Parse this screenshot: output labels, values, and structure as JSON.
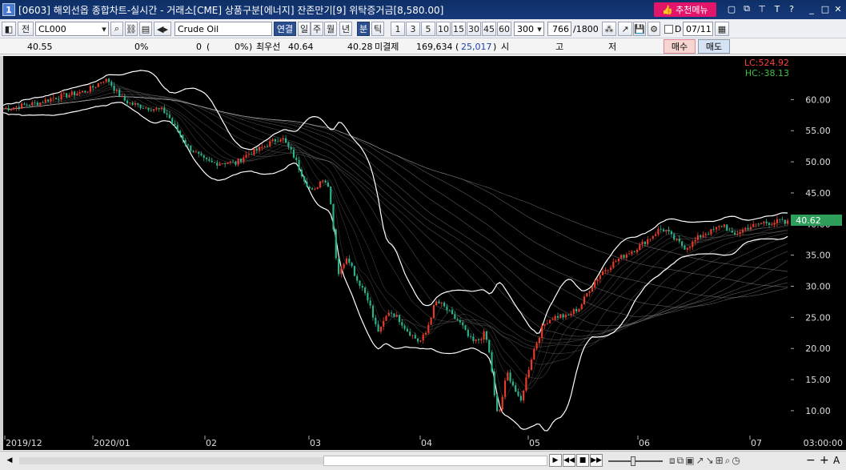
{
  "titlebar": {
    "window_number": "1",
    "title": "[0603] 해외선옵 종합차트-실시간 - 거래소[CME] 상품구분[에너지] 잔존만기[9] 위탁증거금[8,580.00]",
    "recommend_menu": "추천메뉴",
    "pin_label": "T",
    "help_label": "?"
  },
  "toolbar": {
    "market_label": "전",
    "symbol": "CL000",
    "name": "Crude Oil",
    "connect_label": "연결",
    "periods": [
      "일",
      "주",
      "월",
      "년",
      "분",
      "틱"
    ],
    "selected_period": "분",
    "intervals": [
      "1",
      "3",
      "5",
      "10",
      "15",
      "30",
      "45",
      "60"
    ],
    "count": "300",
    "scroll_pos": "766",
    "scroll_total": "/1800",
    "d_label": "D",
    "date": "07/11"
  },
  "quote": {
    "price": "40.55",
    "change_pct": "0%",
    "volume": "0",
    "vol_pct_open": "(",
    "vol_pct": "0%",
    "vol_pct_close": ")",
    "best_ask_label": "최우선",
    "best_ask": "40.64",
    "best_bid": "40.28",
    "open_interest_label": "미결제",
    "open_interest": "169,634",
    "oi_change_open": "(",
    "oi_change": "25,017",
    "oi_change_close": ")",
    "open_label": "시",
    "high_label": "고",
    "low_label": "저",
    "buy_label": "매수",
    "sell_label": "매도"
  },
  "chart": {
    "lc_label": "LC:524.92",
    "hc_label": "HC:-38.13",
    "last_price": "40.62",
    "y_ticks": [
      "60.00",
      "55.00",
      "50.00",
      "45.00",
      "40.00",
      "35.00",
      "30.00",
      "25.00",
      "20.00",
      "15.00",
      "10.00"
    ],
    "x_labels": [
      "2019/12",
      "2020/01",
      "02",
      "03",
      "04",
      "05",
      "06",
      "07"
    ],
    "x_last": "03:00:00",
    "colors": {
      "up": "#e83a2a",
      "down": "#2bb08a",
      "band": "#ffffff",
      "ma": "#9a9a9a",
      "last_price_bg": "#2e9e5b",
      "lc": "#ff4040",
      "hc": "#40c040"
    }
  },
  "chart_data": {
    "type": "candlestick",
    "ylim": [
      6,
      67
    ],
    "price_path": [
      [
        0,
        58.5
      ],
      [
        15,
        58.8
      ],
      [
        30,
        59.2
      ],
      [
        45,
        59.5
      ],
      [
        60,
        60.2
      ],
      [
        75,
        60.6
      ],
      [
        90,
        61.0
      ],
      [
        100,
        61.3
      ],
      [
        110,
        61.8
      ],
      [
        118,
        62.5
      ],
      [
        125,
        63.2
      ],
      [
        132,
        63.0
      ],
      [
        140,
        61.5
      ],
      [
        150,
        60.0
      ],
      [
        160,
        59.3
      ],
      [
        170,
        59.0
      ],
      [
        180,
        58.7
      ],
      [
        190,
        58.5
      ],
      [
        198,
        58.3
      ],
      [
        206,
        57.5
      ],
      [
        212,
        56.0
      ],
      [
        218,
        55.0
      ],
      [
        224,
        53.8
      ],
      [
        230,
        52.5
      ],
      [
        240,
        51.5
      ],
      [
        250,
        50.3
      ],
      [
        260,
        49.8
      ],
      [
        270,
        49.8
      ],
      [
        280,
        50.0
      ],
      [
        290,
        49.7
      ],
      [
        300,
        50.8
      ],
      [
        310,
        51.5
      ],
      [
        320,
        52.0
      ],
      [
        330,
        52.8
      ],
      [
        340,
        53.5
      ],
      [
        348,
        54.0
      ],
      [
        355,
        52.5
      ],
      [
        362,
        51.2
      ],
      [
        368,
        49.5
      ],
      [
        375,
        47.5
      ],
      [
        382,
        45.8
      ],
      [
        388,
        45.0
      ],
      [
        394,
        46.5
      ],
      [
        400,
        47.5
      ],
      [
        406,
        46.0
      ],
      [
        410,
        43.0
      ],
      [
        414,
        37.0
      ],
      [
        418,
        32.0
      ],
      [
        422,
        32.5
      ],
      [
        426,
        34.0
      ],
      [
        430,
        35.0
      ],
      [
        436,
        33.0
      ],
      [
        442,
        31.0
      ],
      [
        448,
        30.0
      ],
      [
        456,
        28.0
      ],
      [
        464,
        24.0
      ],
      [
        470,
        22.5
      ],
      [
        476,
        24.5
      ],
      [
        482,
        26.0
      ],
      [
        488,
        25.5
      ],
      [
        496,
        24.5
      ],
      [
        504,
        23.0
      ],
      [
        512,
        22.0
      ],
      [
        520,
        21.0
      ],
      [
        528,
        22.5
      ],
      [
        534,
        25.0
      ],
      [
        540,
        27.5
      ],
      [
        548,
        27.0
      ],
      [
        556,
        26.0
      ],
      [
        562,
        25.0
      ],
      [
        568,
        24.5
      ],
      [
        574,
        23.5
      ],
      [
        580,
        22.0
      ],
      [
        588,
        21.0
      ],
      [
        596,
        21.5
      ],
      [
        600,
        22.5
      ],
      [
        605,
        21.0
      ],
      [
        610,
        17.0
      ],
      [
        614,
        12.0
      ],
      [
        618,
        9.0
      ],
      [
        622,
        11.0
      ],
      [
        626,
        14.0
      ],
      [
        630,
        16.0
      ],
      [
        636,
        14.5
      ],
      [
        642,
        12.5
      ],
      [
        646,
        11.0
      ],
      [
        650,
        13.5
      ],
      [
        656,
        16.5
      ],
      [
        662,
        19.5
      ],
      [
        668,
        21.5
      ],
      [
        674,
        23.5
      ],
      [
        680,
        24.5
      ],
      [
        688,
        25.0
      ],
      [
        696,
        25.3
      ],
      [
        704,
        25.0
      ],
      [
        712,
        26.0
      ],
      [
        720,
        26.5
      ],
      [
        730,
        29.0
      ],
      [
        740,
        31.0
      ],
      [
        750,
        32.5
      ],
      [
        760,
        33.5
      ],
      [
        770,
        34.5
      ],
      [
        780,
        35.3
      ],
      [
        790,
        36.0
      ],
      [
        800,
        37.0
      ],
      [
        810,
        38.0
      ],
      [
        820,
        39.2
      ],
      [
        828,
        39.0
      ],
      [
        836,
        37.8
      ],
      [
        844,
        37.0
      ],
      [
        852,
        36.2
      ],
      [
        860,
        36.8
      ],
      [
        868,
        37.8
      ],
      [
        876,
        38.5
      ],
      [
        884,
        38.8
      ],
      [
        892,
        39.3
      ],
      [
        900,
        40.0
      ],
      [
        906,
        39.0
      ],
      [
        912,
        38.0
      ],
      [
        920,
        38.8
      ],
      [
        930,
        39.5
      ],
      [
        940,
        39.8
      ],
      [
        950,
        40.3
      ],
      [
        960,
        40.2
      ],
      [
        970,
        40.5
      ],
      [
        978,
        40.0
      ],
      [
        983,
        40.6
      ]
    ]
  },
  "statusbar": {
    "buttons": [
      "◀",
      "▶",
      "◀◀",
      "■",
      "▶▶"
    ],
    "zoom_minus": "−",
    "zoom_plus": "+",
    "font_label": "A"
  }
}
